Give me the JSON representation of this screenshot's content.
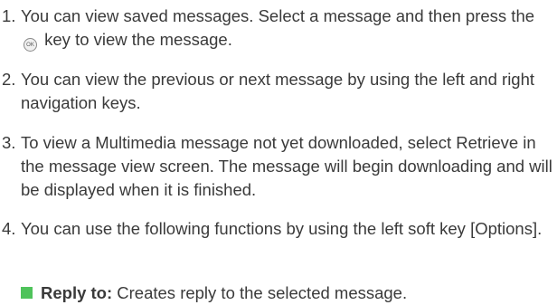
{
  "steps": [
    {
      "number": "1.",
      "text_before_icon": "You can view saved messages. Select a message and then press the",
      "icon": "ok-key-icon",
      "icon_text": "OK",
      "text_after_icon": "key to view the message."
    },
    {
      "number": "2.",
      "text": "You can view the previous or next message by using the left and right navigation keys."
    },
    {
      "number": "3.",
      "text": "To view a Multimedia message not yet downloaded, select Retrieve in the message view screen. The message will begin downloading and will be displayed when it is finished."
    },
    {
      "number": "4.",
      "text": "You can use the following functions by using the left soft key [Options]."
    }
  ],
  "option_items": [
    {
      "label": "Reply to:",
      "description": "Creates reply to the selected message."
    }
  ],
  "colors": {
    "text": "#3a3a3a",
    "bullet": "#4fc35b"
  }
}
